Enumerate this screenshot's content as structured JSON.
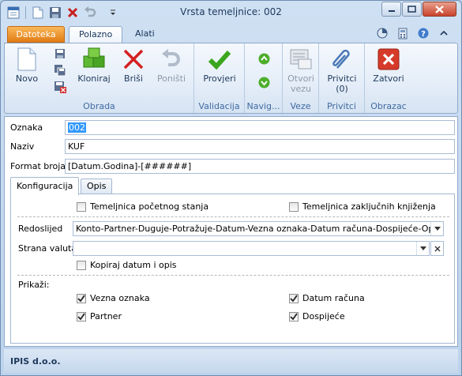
{
  "window": {
    "title": "Vrsta temeljnice: 002"
  },
  "ribbon_tabs": {
    "file": "Datoteka",
    "home": "Polazno",
    "tools": "Alati"
  },
  "ribbon": {
    "obrada": {
      "label": "Obrada",
      "novo": "Novo",
      "kloniraj": "Kloniraj",
      "brisi": "Briši",
      "ponisti": "Poništi"
    },
    "validacija": {
      "label": "Validacija",
      "provjeri": "Provjeri"
    },
    "navigacija": {
      "label": "Navig..."
    },
    "veze": {
      "label": "Veze",
      "otvori_line1": "Otvori",
      "otvori_line2": "vezu"
    },
    "privitci": {
      "label": "Privitci",
      "btn_line1": "Privitci",
      "btn_line2": "(0)"
    },
    "obrazac": {
      "label": "Obrazac",
      "zatvori": "Zatvori"
    }
  },
  "form": {
    "oznaka": {
      "label": "Oznaka",
      "value": "002"
    },
    "naziv": {
      "label": "Naziv",
      "value": "KUF"
    },
    "format_broja": {
      "label": "Format broja",
      "value": "[Datum.Godina]-[######]"
    }
  },
  "tabs": {
    "konfiguracija": "Konfiguracija",
    "opis": "Opis"
  },
  "config": {
    "pocetno_stanje": {
      "label": "Temeljnica početnog stanja",
      "checked": false
    },
    "zakljucni": {
      "label": "Temeljnica zaključnih knjiženja",
      "checked": false
    },
    "redoslijed": {
      "label": "Redoslijed",
      "value": "Konto-Partner-Duguje-Potražuje-Datum-Vezna oznaka-Datum računa-Dospijeće-Opis"
    },
    "strana_valuta": {
      "label": "Strana valuta",
      "value": ""
    },
    "kopiraj": {
      "label": "Kopiraj datum i opis",
      "checked": false
    },
    "prikazi": {
      "label": "Prikaži:"
    },
    "vezna_oznaka": {
      "label": "Vezna oznaka",
      "checked": true
    },
    "datum_racuna": {
      "label": "Datum računa",
      "checked": true
    },
    "partner": {
      "label": "Partner",
      "checked": true
    },
    "dospijece": {
      "label": "Dospijeće",
      "checked": true
    }
  },
  "status": {
    "company": "IPIS d.o.o."
  },
  "colors": {
    "accent": "#e27c14",
    "ribbon_label": "#3e6aa1",
    "selection": "#3399ff"
  }
}
